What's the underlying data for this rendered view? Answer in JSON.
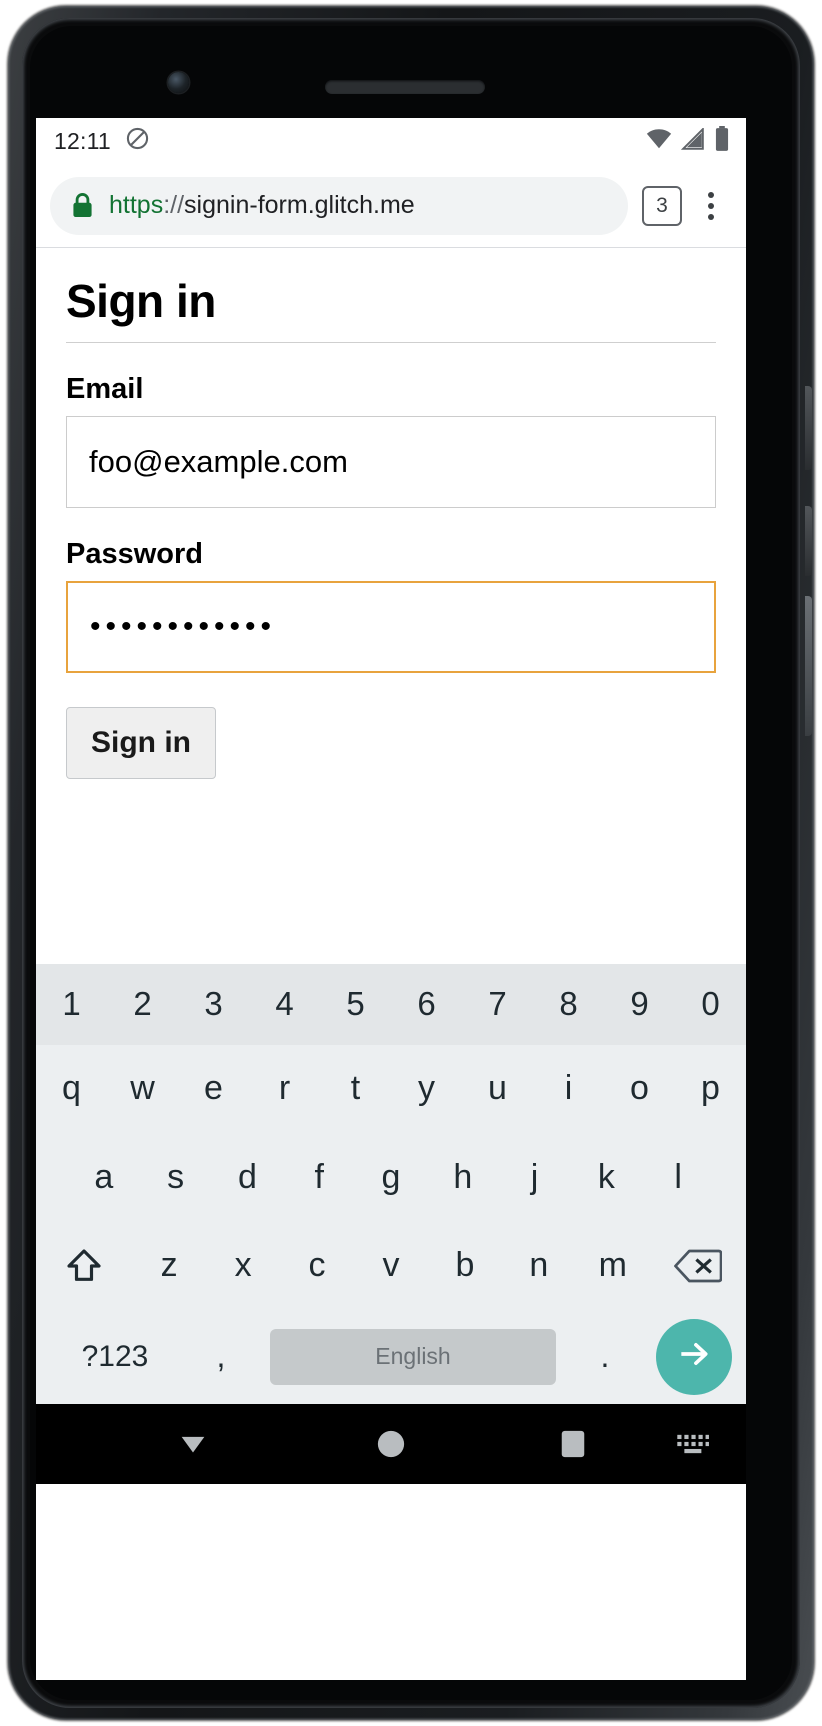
{
  "device": {
    "camera_icon": "front-camera-icon",
    "speaker": "earpiece-speaker"
  },
  "status_bar": {
    "clock": "12:11",
    "left_icons": [
      "do-not-disturb-icon"
    ],
    "right_icons": [
      "wifi-icon",
      "cell-signal-icon",
      "battery-icon"
    ]
  },
  "browser": {
    "lock_icon": "lock-icon",
    "url_scheme": "https",
    "url_separator": "://",
    "url_host": "signin-form.glitch.me",
    "url_full": "https://signin-form.glitch.me",
    "tab_count": "3",
    "menu_icon": "overflow-menu-icon"
  },
  "page": {
    "title": "Sign in",
    "fields": [
      {
        "label": "Email",
        "value": "foo@example.com",
        "placeholder": "",
        "focused": false
      },
      {
        "label": "Password",
        "value": "••••••••••••",
        "placeholder": "",
        "focused": true
      }
    ],
    "submit_label": "Sign in",
    "focus_color": "#e8a33d"
  },
  "keyboard": {
    "number_row": [
      "1",
      "2",
      "3",
      "4",
      "5",
      "6",
      "7",
      "8",
      "9",
      "0"
    ],
    "row_top": [
      "q",
      "w",
      "e",
      "r",
      "t",
      "y",
      "u",
      "i",
      "o",
      "p"
    ],
    "row_home": [
      "a",
      "s",
      "d",
      "f",
      "g",
      "h",
      "j",
      "k",
      "l"
    ],
    "row_shift": [
      "z",
      "x",
      "c",
      "v",
      "b",
      "n",
      "m"
    ],
    "shift_icon": "shift-icon",
    "backspace_icon": "backspace-icon",
    "symbols_label": "?123",
    "comma_label": ",",
    "space_label": "English",
    "period_label": ".",
    "enter_icon": "arrow-right-icon",
    "enter_color": "#4db6ac"
  },
  "nav_bar": {
    "back_icon": "hide-keyboard-down-icon",
    "home_icon": "home-circle-icon",
    "recents_icon": "recents-square-icon",
    "ime_icon": "keyboard-switcher-icon"
  }
}
